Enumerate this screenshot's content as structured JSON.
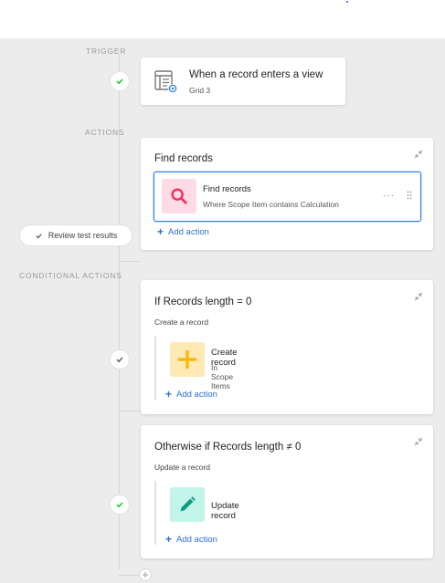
{
  "sections": {
    "trigger": "TRIGGER",
    "actions": "ACTIONS",
    "conditional": "CONDITIONAL ACTIONS"
  },
  "trigger": {
    "title": "When a record enters a view",
    "subtitle": "Grid 3"
  },
  "actions": {
    "card_title": "Find records",
    "item_title": "Find records",
    "item_sub": "Where Scope Item contains Calculation",
    "more_label": "···",
    "add_action": "Add action"
  },
  "review_button": "Review test results",
  "conditions": [
    {
      "title": "If Records length = 0",
      "subtitle": "Create a record",
      "item_title": "Create record",
      "item_sub": "In Scope Items",
      "add_action": "Add action"
    },
    {
      "title": "Otherwise if Records length ≠ 0",
      "subtitle": "Update a record",
      "item_title": "Update record",
      "add_action": "Add action"
    }
  ],
  "colors": {
    "accent_blue": "#2d7ff9",
    "success_green": "#20c933",
    "find_tile": "#ffdce5",
    "find_icon": "#f82b60",
    "create_tile": "#ffeab6",
    "create_icon": "#fcb400",
    "update_tile": "#c2f5e9",
    "update_icon": "#20d9b2"
  },
  "icons": {
    "trigger": "table-view-icon",
    "find": "search-icon",
    "create": "plus-icon",
    "update": "pencil-icon"
  }
}
